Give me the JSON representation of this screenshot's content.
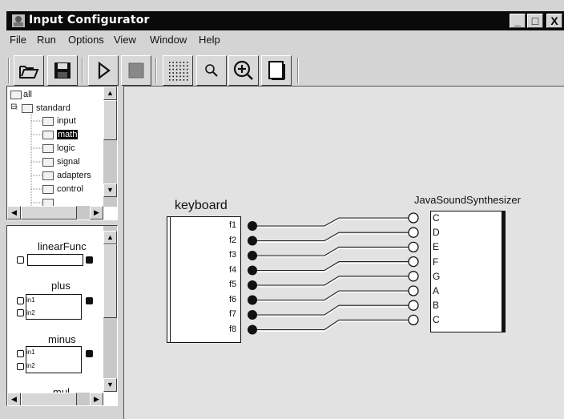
{
  "window": {
    "title": "Input Configurator",
    "min_glyph": "_",
    "max_glyph": "□",
    "close_glyph": "X"
  },
  "menu": [
    "File",
    "Run",
    "Options",
    "View",
    "Window",
    "Help"
  ],
  "toolbar": [
    "open-icon",
    "save-icon",
    "run-icon",
    "stop-icon",
    "grid-icon",
    "zoom-out-icon",
    "zoom-in-icon",
    "page-icon"
  ],
  "tree": {
    "items": [
      {
        "label": "all"
      },
      {
        "label": "standard",
        "expander": "⊟"
      },
      {
        "label": "input"
      },
      {
        "label": "math"
      },
      {
        "label": "logic"
      },
      {
        "label": "signal"
      },
      {
        "label": "adapters"
      },
      {
        "label": "control"
      }
    ]
  },
  "palette": {
    "items": [
      {
        "label": "linearFunc"
      },
      {
        "label": "plus",
        "in1": "in1",
        "in2": "in2"
      },
      {
        "label": "minus",
        "in1": "in1",
        "in2": "in2"
      },
      {
        "label": "mul"
      }
    ]
  },
  "canvas": {
    "keyboard": {
      "title": "keyboard",
      "ports": [
        "f1",
        "f2",
        "f3",
        "f4",
        "f5",
        "f6",
        "f7",
        "f8"
      ]
    },
    "synth": {
      "title": "JavaSoundSynthesizer",
      "ports": [
        "C",
        "D",
        "E",
        "F",
        "G",
        "A",
        "B",
        "C"
      ]
    }
  },
  "colors": {
    "titlebar": "#0a0a0a",
    "canvas": "#e2e2e2",
    "chrome": "#d4d4d4"
  }
}
